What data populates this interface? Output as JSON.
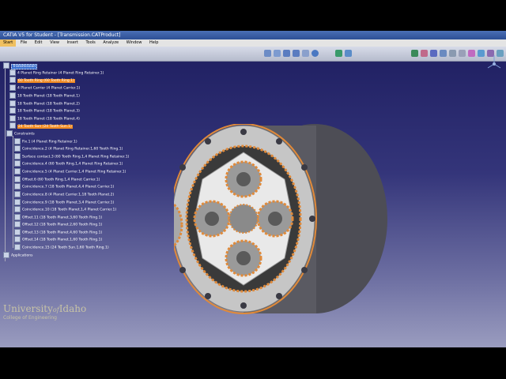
{
  "window": {
    "title": "CATIA V5 for Student - [Transmission.CATProduct]"
  },
  "menu": [
    "Start",
    "File",
    "Edit",
    "View",
    "Insert",
    "Tools",
    "Analyze",
    "Window",
    "Help"
  ],
  "tree": {
    "root": "Transmission",
    "parts": [
      {
        "label": "4 Planet Ring Retainer (4 Planet Ring Retainer.1)",
        "highlight": false
      },
      {
        "label": "60 Tooth Ring (60 Tooth Ring.1)",
        "highlight": true
      },
      {
        "label": "4 Planet Carrier (4 Planet Carrier.1)",
        "highlight": false
      },
      {
        "label": "18 Tooth Planet (18 Tooth Planet.1)",
        "highlight": false
      },
      {
        "label": "18 Tooth Planet (18 Tooth Planet.2)",
        "highlight": false
      },
      {
        "label": "18 Tooth Planet (18 Tooth Planet.3)",
        "highlight": false
      },
      {
        "label": "18 Tooth Planet (18 Tooth Planet.4)",
        "highlight": false
      },
      {
        "label": "24 Tooth Sun (24 Tooth Sun.1)",
        "highlight": true
      }
    ],
    "constraints_label": "Constraints",
    "constraints": [
      "Fix.1 (4 Planet Ring Retainer.1)",
      "Coincidence.2 (4 Planet Ring Retainer.1,60 Tooth Ring.1)",
      "Surface contact.3 (60 Tooth Ring.1,4 Planet Ring Retainer.1)",
      "Coincidence.4 (60 Tooth Ring.1,4 Planet Ring Retainer.1)",
      "Coincidence.5 (4 Planet Carrier.1,4 Planet Ring Retainer.1)",
      "Offset.6 (60 Tooth Ring.1,4 Planet Carrier.1)",
      "Coincidence.7 (18 Tooth Planet.4,4 Planet Carrier.1)",
      "Coincidence.8 (4 Planet Carrier.1,18 Tooth Planet.2)",
      "Coincidence.9 (18 Tooth Planet.3,4 Planet Carrier.1)",
      "Coincidence.10 (18 Tooth Planet.1,4 Planet Carrier.1)",
      "Offset.11 (18 Tooth Planet.3,60 Tooth Ring.1)",
      "Offset.12 (18 Tooth Planet.2,60 Tooth Ring.1)",
      "Offset.13 (18 Tooth Planet.4,60 Tooth Ring.1)",
      "Offset.14 (18 Tooth Planet.1,60 Tooth Ring.1)",
      "Coincidence.15 (24 Tooth Sun.1,60 Tooth Ring.1)"
    ],
    "applications_label": "Applications"
  },
  "logo": {
    "line1_a": "University",
    "line1_of": "of",
    "line1_b": "Idaho",
    "line2": "College of Engineering"
  },
  "colors": {
    "highlight": "#f08a22",
    "gear_gray": "#b9b9b9",
    "ring_edge": "#e08a3a",
    "bg_top": "#1c1c5e",
    "bg_bottom": "#9a9cbf"
  }
}
